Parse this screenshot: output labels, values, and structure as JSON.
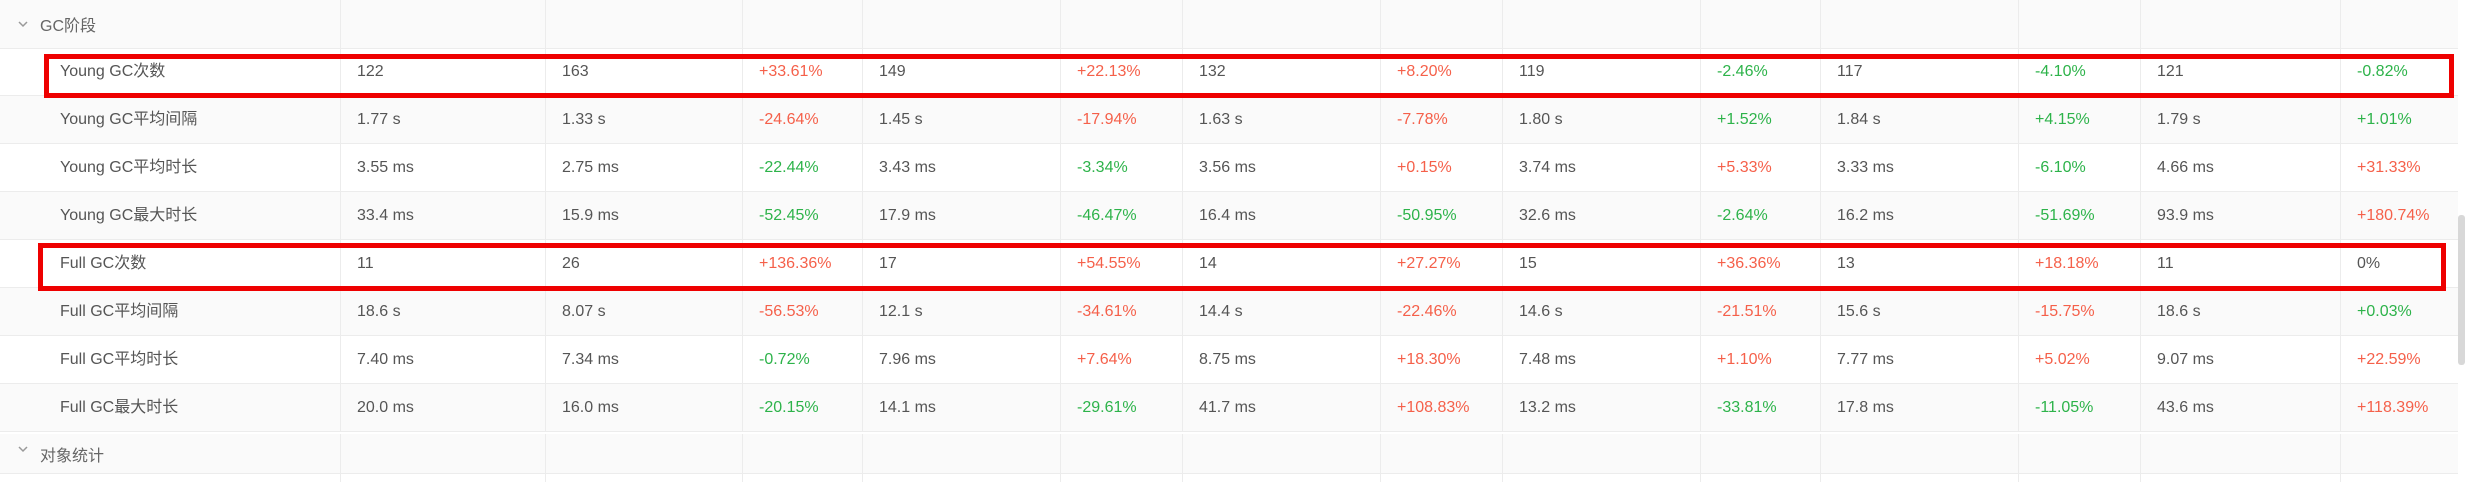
{
  "groups": {
    "gc_stage": "GC阶段",
    "object_stats": "对象统计"
  },
  "rows": [
    {
      "label": "Young GC次数",
      "cells": [
        {
          "v": "122",
          "t": "val"
        },
        {
          "v": "163",
          "t": "val"
        },
        {
          "v": "+33.61%",
          "t": "pos"
        },
        {
          "v": "149",
          "t": "val"
        },
        {
          "v": "+22.13%",
          "t": "pos"
        },
        {
          "v": "132",
          "t": "val"
        },
        {
          "v": "+8.20%",
          "t": "pos"
        },
        {
          "v": "119",
          "t": "val"
        },
        {
          "v": "-2.46%",
          "t": "neg"
        },
        {
          "v": "117",
          "t": "val"
        },
        {
          "v": "-4.10%",
          "t": "neg"
        },
        {
          "v": "121",
          "t": "val"
        },
        {
          "v": "-0.82%",
          "t": "neg"
        }
      ]
    },
    {
      "label": "Young GC平均间隔",
      "cells": [
        {
          "v": "1.77 s",
          "t": "val"
        },
        {
          "v": "1.33 s",
          "t": "val"
        },
        {
          "v": "-24.64%",
          "t": "pos"
        },
        {
          "v": "1.45 s",
          "t": "val"
        },
        {
          "v": "-17.94%",
          "t": "pos"
        },
        {
          "v": "1.63 s",
          "t": "val"
        },
        {
          "v": "-7.78%",
          "t": "pos"
        },
        {
          "v": "1.80 s",
          "t": "val"
        },
        {
          "v": "+1.52%",
          "t": "neg"
        },
        {
          "v": "1.84 s",
          "t": "val"
        },
        {
          "v": "+4.15%",
          "t": "neg"
        },
        {
          "v": "1.79 s",
          "t": "val"
        },
        {
          "v": "+1.01%",
          "t": "neg"
        }
      ]
    },
    {
      "label": "Young GC平均时长",
      "cells": [
        {
          "v": "3.55 ms",
          "t": "val"
        },
        {
          "v": "2.75 ms",
          "t": "val"
        },
        {
          "v": "-22.44%",
          "t": "neg"
        },
        {
          "v": "3.43 ms",
          "t": "val"
        },
        {
          "v": "-3.34%",
          "t": "neg"
        },
        {
          "v": "3.56 ms",
          "t": "val"
        },
        {
          "v": "+0.15%",
          "t": "pos"
        },
        {
          "v": "3.74 ms",
          "t": "val"
        },
        {
          "v": "+5.33%",
          "t": "pos"
        },
        {
          "v": "3.33 ms",
          "t": "val"
        },
        {
          "v": "-6.10%",
          "t": "neg"
        },
        {
          "v": "4.66 ms",
          "t": "val"
        },
        {
          "v": "+31.33%",
          "t": "pos"
        }
      ]
    },
    {
      "label": "Young GC最大时长",
      "cells": [
        {
          "v": "33.4 ms",
          "t": "val"
        },
        {
          "v": "15.9 ms",
          "t": "val"
        },
        {
          "v": "-52.45%",
          "t": "neg"
        },
        {
          "v": "17.9 ms",
          "t": "val"
        },
        {
          "v": "-46.47%",
          "t": "neg"
        },
        {
          "v": "16.4 ms",
          "t": "val"
        },
        {
          "v": "-50.95%",
          "t": "neg"
        },
        {
          "v": "32.6 ms",
          "t": "val"
        },
        {
          "v": "-2.64%",
          "t": "neg"
        },
        {
          "v": "16.2 ms",
          "t": "val"
        },
        {
          "v": "-51.69%",
          "t": "neg"
        },
        {
          "v": "93.9 ms",
          "t": "val"
        },
        {
          "v": "+180.74%",
          "t": "pos"
        }
      ]
    },
    {
      "label": "Full GC次数",
      "cells": [
        {
          "v": "11",
          "t": "val"
        },
        {
          "v": "26",
          "t": "val"
        },
        {
          "v": "+136.36%",
          "t": "pos"
        },
        {
          "v": "17",
          "t": "val"
        },
        {
          "v": "+54.55%",
          "t": "pos"
        },
        {
          "v": "14",
          "t": "val"
        },
        {
          "v": "+27.27%",
          "t": "pos"
        },
        {
          "v": "15",
          "t": "val"
        },
        {
          "v": "+36.36%",
          "t": "pos"
        },
        {
          "v": "13",
          "t": "val"
        },
        {
          "v": "+18.18%",
          "t": "pos"
        },
        {
          "v": "11",
          "t": "val"
        },
        {
          "v": "0%",
          "t": "zero"
        }
      ]
    },
    {
      "label": "Full GC平均间隔",
      "cells": [
        {
          "v": "18.6 s",
          "t": "val"
        },
        {
          "v": "8.07 s",
          "t": "val"
        },
        {
          "v": "-56.53%",
          "t": "pos"
        },
        {
          "v": "12.1 s",
          "t": "val"
        },
        {
          "v": "-34.61%",
          "t": "pos"
        },
        {
          "v": "14.4 s",
          "t": "val"
        },
        {
          "v": "-22.46%",
          "t": "pos"
        },
        {
          "v": "14.6 s",
          "t": "val"
        },
        {
          "v": "-21.51%",
          "t": "pos"
        },
        {
          "v": "15.6 s",
          "t": "val"
        },
        {
          "v": "-15.75%",
          "t": "pos"
        },
        {
          "v": "18.6 s",
          "t": "val"
        },
        {
          "v": "+0.03%",
          "t": "neg"
        }
      ]
    },
    {
      "label": "Full GC平均时长",
      "cells": [
        {
          "v": "7.40 ms",
          "t": "val"
        },
        {
          "v": "7.34 ms",
          "t": "val"
        },
        {
          "v": "-0.72%",
          "t": "neg"
        },
        {
          "v": "7.96 ms",
          "t": "val"
        },
        {
          "v": "+7.64%",
          "t": "pos"
        },
        {
          "v": "8.75 ms",
          "t": "val"
        },
        {
          "v": "+18.30%",
          "t": "pos"
        },
        {
          "v": "7.48 ms",
          "t": "val"
        },
        {
          "v": "+1.10%",
          "t": "pos"
        },
        {
          "v": "7.77 ms",
          "t": "val"
        },
        {
          "v": "+5.02%",
          "t": "pos"
        },
        {
          "v": "9.07 ms",
          "t": "val"
        },
        {
          "v": "+22.59%",
          "t": "pos"
        }
      ]
    },
    {
      "label": "Full GC最大时长",
      "cells": [
        {
          "v": "20.0 ms",
          "t": "val"
        },
        {
          "v": "16.0 ms",
          "t": "val"
        },
        {
          "v": "-20.15%",
          "t": "neg"
        },
        {
          "v": "14.1 ms",
          "t": "val"
        },
        {
          "v": "-29.61%",
          "t": "neg"
        },
        {
          "v": "41.7 ms",
          "t": "val"
        },
        {
          "v": "+108.83%",
          "t": "pos"
        },
        {
          "v": "13.2 ms",
          "t": "val"
        },
        {
          "v": "-33.81%",
          "t": "neg"
        },
        {
          "v": "17.8 ms",
          "t": "val"
        },
        {
          "v": "-11.05%",
          "t": "neg"
        },
        {
          "v": "43.6 ms",
          "t": "val"
        },
        {
          "v": "+118.39%",
          "t": "pos"
        }
      ]
    }
  ],
  "colors": {
    "increase": "#f5604a",
    "decrease": "#2db34a",
    "highlight": "#ee0000"
  },
  "icons": {
    "group_toggle": "chevron-down-icon"
  }
}
